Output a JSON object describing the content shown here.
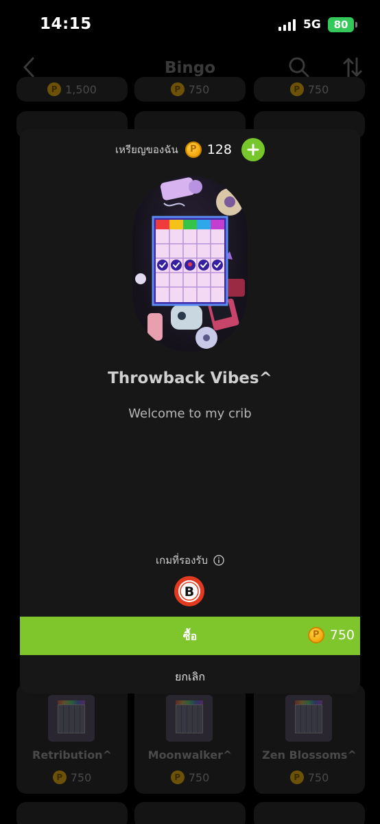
{
  "status_bar": {
    "time": "14:15",
    "network": "5G",
    "battery": "80"
  },
  "nav": {
    "title": "Bingo"
  },
  "modal": {
    "balance_label": "เหรียญของฉัน",
    "coin_symbol": "P",
    "balance": "128",
    "card_title": "Throwback Vibes^",
    "card_subtitle": "Welcome to my crib",
    "supported_games_label": "เกมที่รองรับ",
    "game_badge_letter": "B",
    "buy_label": "ซื้อ",
    "price": "750",
    "cancel_label": "ยกเลิก"
  },
  "background_grid": {
    "top_row_prices": [
      "1,500",
      "750",
      "750"
    ],
    "bottom_cards": [
      {
        "title": "Retribution^",
        "price": "750"
      },
      {
        "title": "Moonwalker^",
        "price": "750"
      },
      {
        "title": "Zen Blossoms^",
        "price": "750"
      }
    ]
  },
  "colors": {
    "accent_green": "#7fc62d",
    "coin_gold": "#f2a50c",
    "modal_bg": "#171717"
  }
}
